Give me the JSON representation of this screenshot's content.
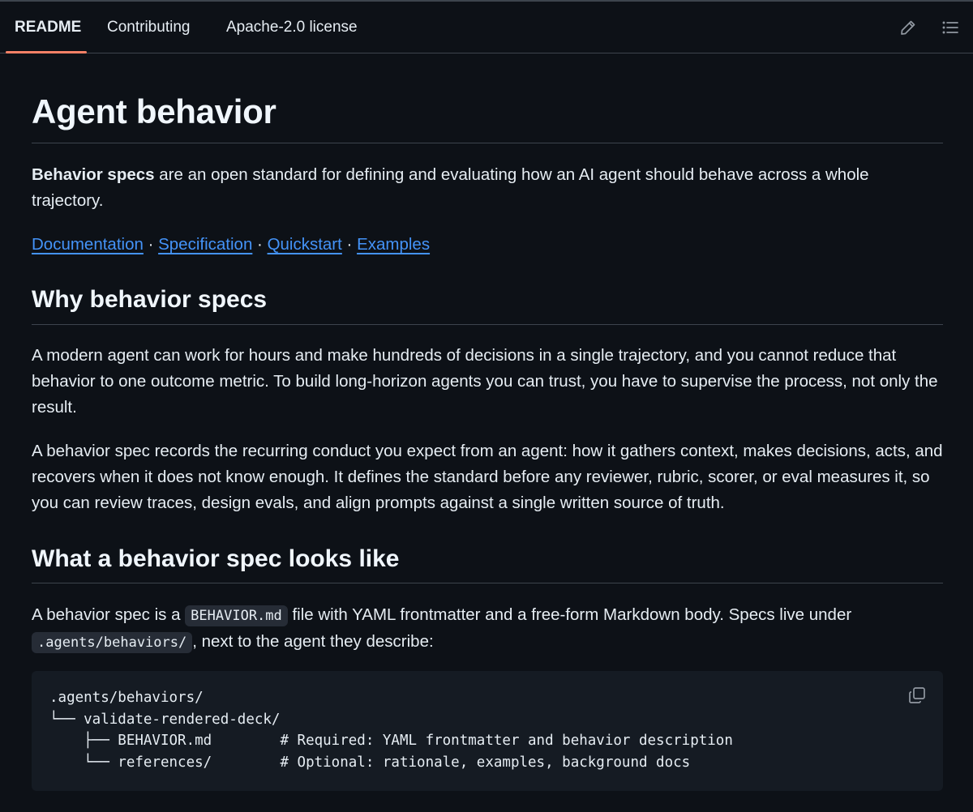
{
  "tabs": [
    {
      "label": "README",
      "active": true
    },
    {
      "label": "Contributing",
      "active": false
    },
    {
      "label": "Apache-2.0 license",
      "active": false
    }
  ],
  "toolbar": {
    "edit_icon": "pencil-icon",
    "outline_icon": "list-icon"
  },
  "readme": {
    "title": "Agent behavior",
    "intro_bold": "Behavior specs",
    "intro_rest": " are an open standard for defining and evaluating how an AI agent should behave across a whole trajectory.",
    "links": [
      "Documentation",
      "Specification",
      "Quickstart",
      "Examples"
    ],
    "link_separator": " · ",
    "section1": {
      "heading": "Why behavior specs",
      "para1": "A modern agent can work for hours and make hundreds of decisions in a single trajectory, and you cannot reduce that behavior to one outcome metric. To build long-horizon agents you can trust, you have to supervise the process, not only the result.",
      "para2": "A behavior spec records the recurring conduct you expect from an agent: how it gathers context, makes decisions, acts, and recovers when it does not know enough. It defines the standard before any reviewer, rubric, scorer, or eval measures it, so you can review traces, design evals, and align prompts against a single written source of truth."
    },
    "section2": {
      "heading": "What a behavior spec looks like",
      "text_a": "A behavior spec is a ",
      "code_a": "BEHAVIOR.md",
      "text_b": " file with YAML frontmatter and a free-form Markdown body. Specs live under ",
      "code_b": ".agents/behaviors/",
      "text_c": ", next to the agent they describe:",
      "code_lines": [
        ".agents/behaviors/",
        "└── validate-rendered-deck/",
        "    ├── BEHAVIOR.md        # Required: YAML frontmatter and behavior description",
        "    └── references/        # Optional: rationale, examples, background docs"
      ],
      "copy_icon": "copy-icon"
    }
  },
  "colors": {
    "background": "#0d1117",
    "text": "#e6edf3",
    "link": "#4493f8",
    "tab_underline": "#f78166",
    "border": "#3d444d",
    "code_bg": "#151b23"
  }
}
